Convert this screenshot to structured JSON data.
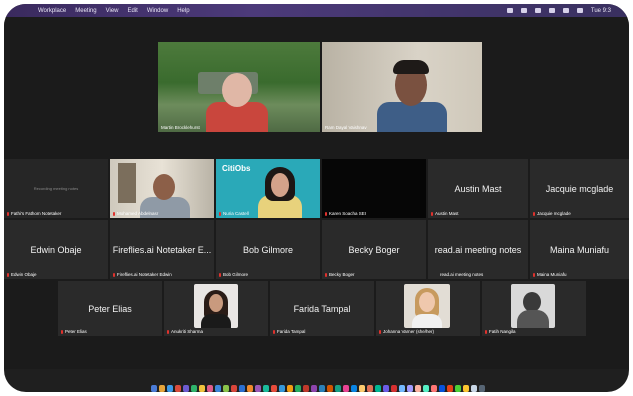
{
  "menubar": {
    "app_items": [
      "Workplace",
      "Meeting",
      "View",
      "Edit",
      "Window",
      "Help"
    ],
    "clock": "Tue 9:3"
  },
  "speakers": [
    {
      "name": "Martin Brocklehurst"
    },
    {
      "name": "Ram Dayal Vaishnav"
    }
  ],
  "row1": [
    {
      "name": "Fathi's Fathom Notetaker",
      "center_text": "Recording meeting notes"
    },
    {
      "name": "Mohamed Abdelnasr"
    },
    {
      "name": "Nuria Castell",
      "logo_text": "CitiObs"
    },
    {
      "name": "Karen Soacha SEI"
    },
    {
      "name": "Austin Mast",
      "display_name": "Austin Mast"
    },
    {
      "name": "Jacquie mcglade",
      "display_name": "Jacquie mcglade"
    }
  ],
  "row2": [
    {
      "name": "Edwin Obaje",
      "display_name": "Edwin Obaje"
    },
    {
      "name": "Fireflies.ai Notetaker Edwin",
      "display_name": "Fireflies.ai Notetaker E..."
    },
    {
      "name": "Bob Gilmore",
      "display_name": "Bob Gilmore"
    },
    {
      "name": "Becky Boger",
      "display_name": "Becky Boger"
    },
    {
      "name": "read.ai meeting notes",
      "display_name": "read.ai meeting notes"
    },
    {
      "name": "Maina Muniafu",
      "display_name": "Maina Muniafu"
    }
  ],
  "row3": [
    {
      "name": "Peter Elias",
      "display_name": "Peter Elias"
    },
    {
      "name": "Anukriti Sharma"
    },
    {
      "name": "Farida Tampal",
      "display_name": "Farida Tampal"
    },
    {
      "name": "Johanna Varner (she/her)"
    },
    {
      "name": "Fatih Nangila"
    }
  ],
  "colors": {
    "accent_mic": "#e0322d",
    "citiobs_teal": "#2aa9b8"
  }
}
